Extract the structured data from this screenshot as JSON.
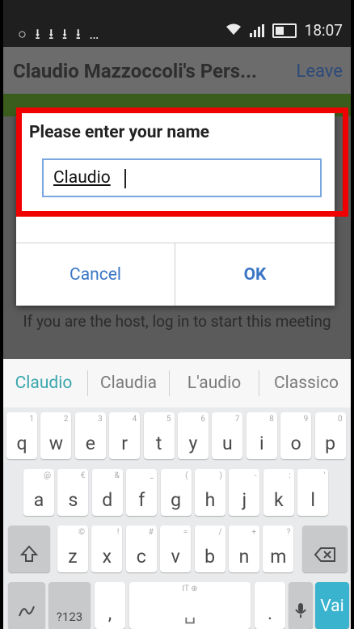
{
  "statusbar": {
    "left_icons": "○ ⭳ ⭳ ⭳ ⭳ …",
    "time": "18:07"
  },
  "appbar": {
    "title": "Claudio Mazzoccoli's Pers...",
    "leave": "Leave"
  },
  "dialog": {
    "title": "Please enter your name",
    "input_value": "Claudio",
    "cancel": "Cancel",
    "ok": "OK"
  },
  "host_text": "If you are the host, log in to start this meeting",
  "suggestions": [
    "Claudio",
    "Claudia",
    "L'audio",
    "Classico"
  ],
  "keyboard": {
    "row1": [
      {
        "k": "q",
        "h": "1"
      },
      {
        "k": "w",
        "h": "2"
      },
      {
        "k": "e",
        "h": "3"
      },
      {
        "k": "r",
        "h": "4"
      },
      {
        "k": "t",
        "h": "5"
      },
      {
        "k": "y",
        "h": "6"
      },
      {
        "k": "u",
        "h": "7"
      },
      {
        "k": "i",
        "h": "8"
      },
      {
        "k": "o",
        "h": "9"
      },
      {
        "k": "p",
        "h": "0"
      }
    ],
    "row2": [
      {
        "k": "a",
        "h": "@"
      },
      {
        "k": "s",
        "h": "€"
      },
      {
        "k": "d",
        "h": "&"
      },
      {
        "k": "f",
        "h": "_"
      },
      {
        "k": "g",
        "h": "("
      },
      {
        "k": "h",
        "h": ")"
      },
      {
        "k": "j",
        "h": "-"
      },
      {
        "k": "k",
        "h": ":"
      },
      {
        "k": "l",
        "h": "'"
      }
    ],
    "row3": [
      {
        "k": "z",
        "h": "©"
      },
      {
        "k": "x",
        "h": "!"
      },
      {
        "k": "c",
        "h": "#"
      },
      {
        "k": "v",
        "h": "="
      },
      {
        "k": "b",
        "h": "/"
      },
      {
        "k": "n",
        "h": "+"
      },
      {
        "k": "m",
        "h": "?"
      }
    ],
    "symbols": "?123",
    "comma": ",",
    "period": ".",
    "space_hint": "IT ⊕",
    "go": "Vai"
  }
}
